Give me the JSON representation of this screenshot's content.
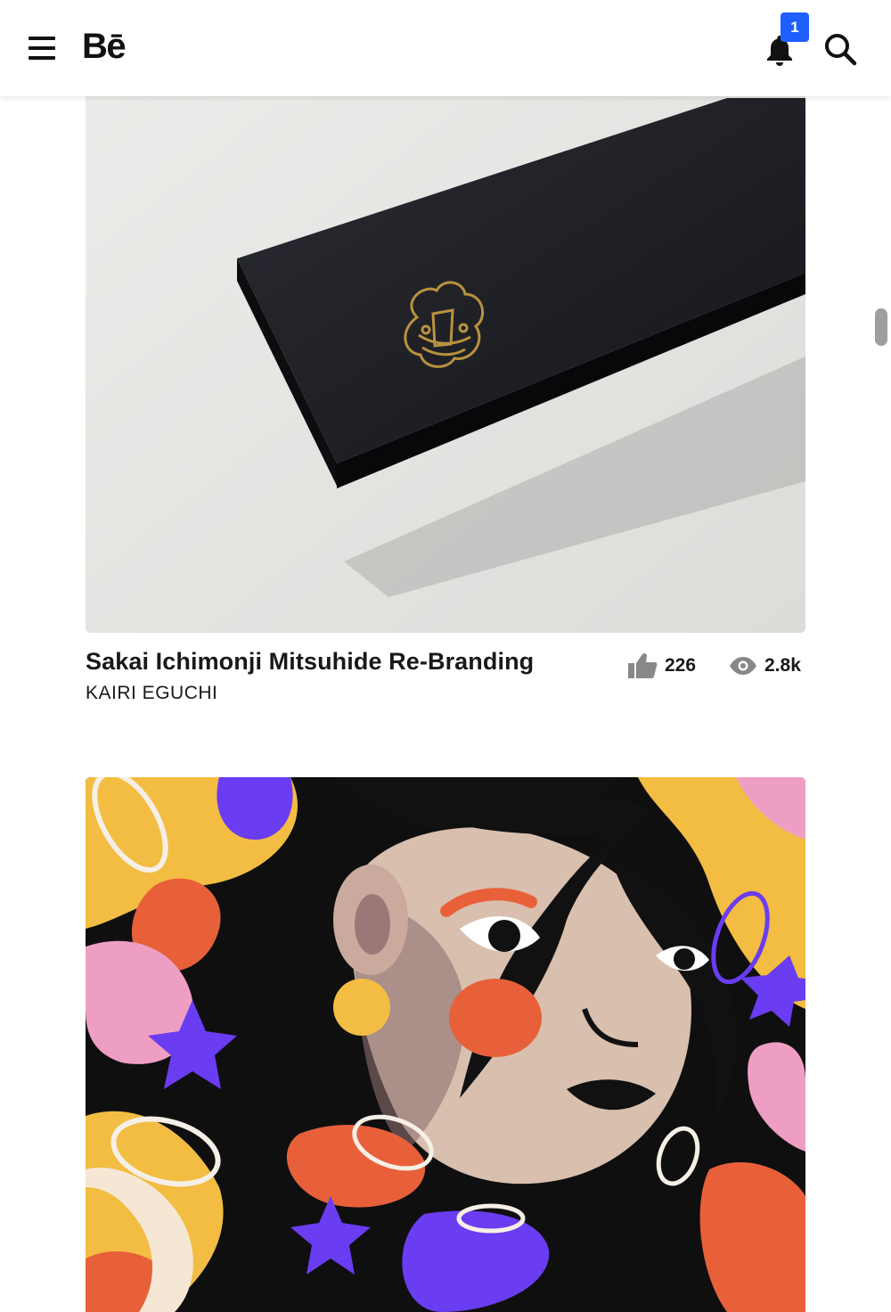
{
  "header": {
    "logo_text": "Bē",
    "notification_count": "1",
    "menu_icon": "hamburger-menu-icon",
    "notification_icon": "bell-icon",
    "search_icon": "search-icon",
    "badge_color": "#1f5eff"
  },
  "projects": [
    {
      "title": "Sakai Ichimonji Mitsuhide Re-Branding",
      "owner": "KAIRI EGUCHI",
      "likes": "226",
      "views": "2.8k",
      "like_icon": "thumbs-up-icon",
      "view_icon": "eye-icon"
    },
    {
      "title": "",
      "owner": ""
    }
  ]
}
